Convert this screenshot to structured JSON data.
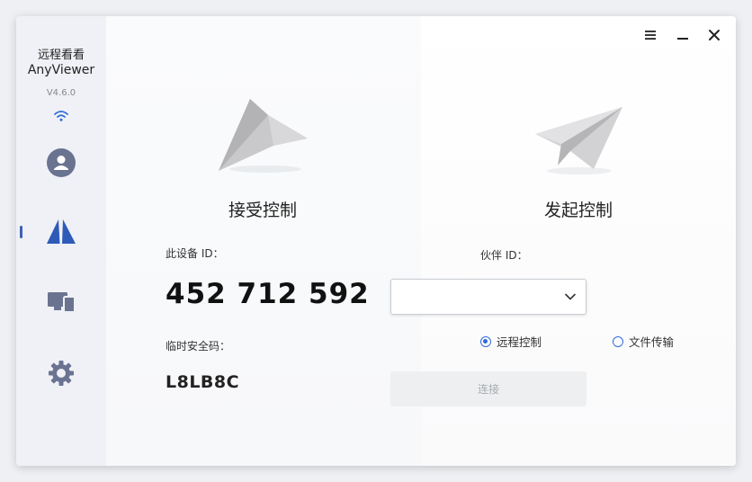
{
  "app": {
    "name_cn": "远程看看",
    "name_en": "AnyViewer",
    "version": "V4.6.0"
  },
  "sidebar": {
    "items": [
      {
        "icon": "user-icon",
        "label": "account"
      },
      {
        "icon": "remote-control-icon",
        "label": "remote control",
        "active": true
      },
      {
        "icon": "devices-icon",
        "label": "devices"
      },
      {
        "icon": "settings-icon",
        "label": "settings"
      }
    ]
  },
  "receive": {
    "title": "接受控制",
    "device_id_label": "此设备 ID：",
    "device_id": "452 712 592",
    "temp_code_label": "临时安全码：",
    "temp_code": "L8LB8C"
  },
  "control": {
    "title": "发起控制",
    "partner_id_label": "伙伴 ID：",
    "partner_id_value": "",
    "modes": [
      {
        "label": "远程控制",
        "selected": true
      },
      {
        "label": "文件传输",
        "selected": false
      }
    ],
    "connect_label": "连接"
  },
  "colors": {
    "accent": "#2f6bd8",
    "nav_active": "#3f5fb8",
    "nav_icon": "#6a7390"
  }
}
